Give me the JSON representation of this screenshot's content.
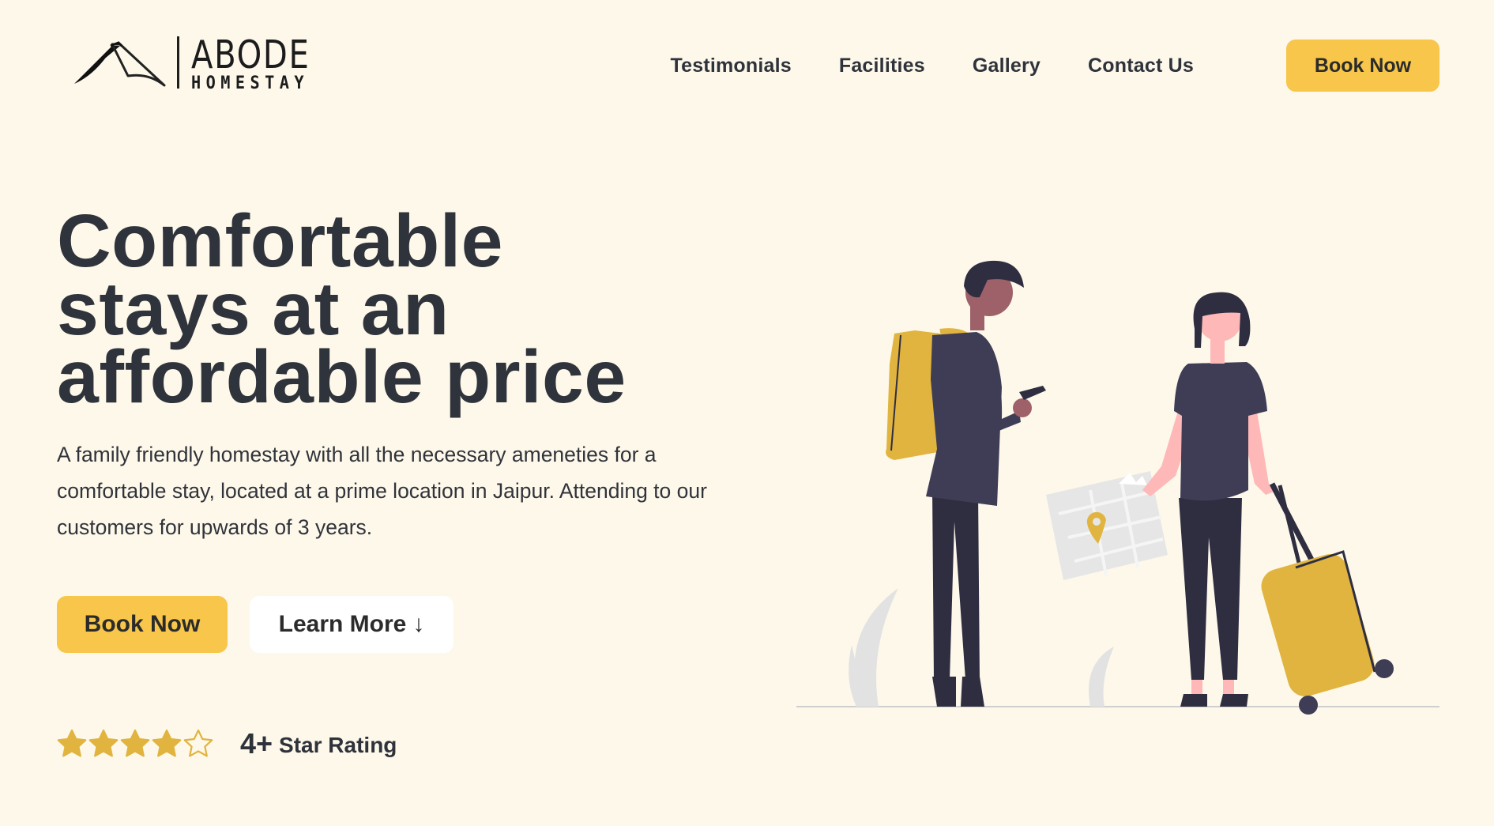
{
  "brand": {
    "name": "ABODE",
    "tagline": "HOMESTAY"
  },
  "nav": {
    "links": [
      "Testimonials",
      "Facilities",
      "Gallery",
      "Contact Us"
    ],
    "cta": "Book Now"
  },
  "hero": {
    "title_lines": [
      "Comfortable",
      "stays at an",
      "affordable price"
    ],
    "description": "A family friendly homestay with all the necessary ameneties for a comfortable stay, located at a prime location in Jaipur. Attending to our customers for upwards of 3 years.",
    "primary_button": "Book Now",
    "secondary_button": "Learn More",
    "secondary_button_icon": "↓"
  },
  "rating": {
    "value": "4+",
    "label": "Star Rating",
    "filled_stars": 4,
    "total_stars": 5
  },
  "colors": {
    "background": "#fdf8ea",
    "accent": "#f7c64a",
    "text": "#2f333b",
    "star": "#e0b43f",
    "bag": "#e0b43f"
  },
  "icons": {
    "logo": "tent-logo-icon",
    "star": "star-icon",
    "arrow": "arrow-down-icon"
  }
}
